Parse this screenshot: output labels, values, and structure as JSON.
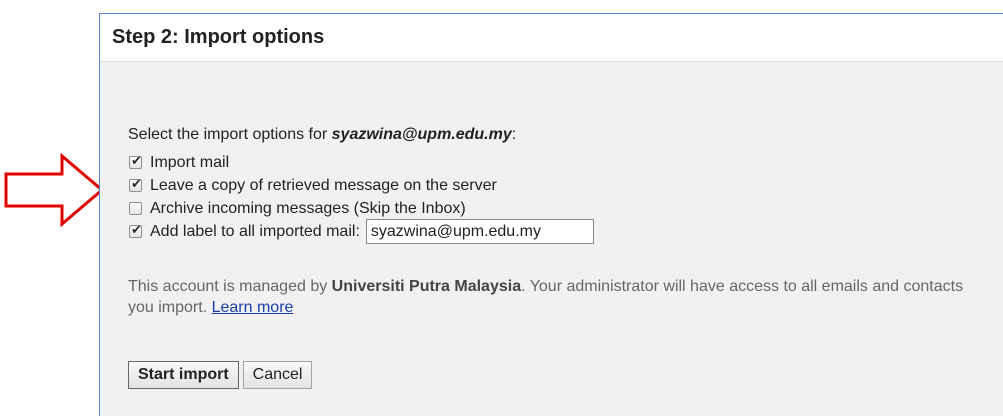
{
  "dialog": {
    "title": "Step 2: Import options"
  },
  "intro": {
    "prefix": "Select the import options for ",
    "email": "syazwina@upm.edu.my",
    "suffix": ":"
  },
  "options": [
    {
      "label": "Import mail",
      "checked": true
    },
    {
      "label": "Leave a copy of retrieved message on the server",
      "checked": true
    },
    {
      "label": "Archive incoming messages (Skip the Inbox)",
      "checked": false
    },
    {
      "label": "Add label to all imported mail:",
      "checked": true
    }
  ],
  "label_input": {
    "value": "syazwina@upm.edu.my"
  },
  "note": {
    "prefix": "This account is managed by ",
    "org": "Universiti Putra Malaysia",
    "suffix": ". Your administrator will have access to all emails and contacts you import. ",
    "link": "Learn more"
  },
  "buttons": {
    "start": "Start import",
    "cancel": "Cancel"
  },
  "colors": {
    "annotation_arrow": "#e00000",
    "dialog_border": "#5b87c7",
    "link": "#1b3ea8"
  }
}
